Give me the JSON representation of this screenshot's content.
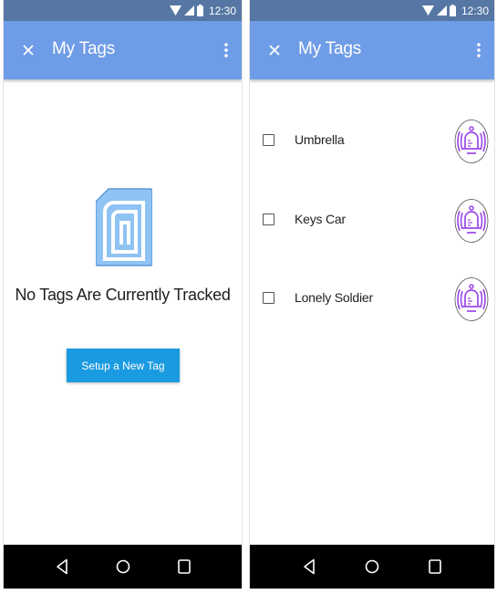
{
  "status": {
    "time": "12:30"
  },
  "colors": {
    "status_bar": "#5677a4",
    "app_bar": "#6f9ce6",
    "button": "#1a9ae0",
    "bell": "#9a47e8"
  },
  "left_screen": {
    "title": "My Tags",
    "empty_message": "No Tags Are Currently Tracked",
    "setup_button_label": "Setup a New Tag"
  },
  "right_screen": {
    "title": "My Tags",
    "tags": [
      {
        "label": "Umbrella",
        "checked": false
      },
      {
        "label": "Keys Car",
        "checked": false
      },
      {
        "label": "Lonely Soldier",
        "checked": false
      }
    ]
  },
  "icons": {
    "close": "close-icon",
    "menu": "more-vert-icon",
    "back": "back-icon",
    "home": "home-icon",
    "recents": "recents-icon",
    "empty": "tag-card-icon",
    "alert": "bell-alert-icon",
    "wifi": "wifi-icon",
    "signal": "signal-icon",
    "battery": "battery-icon"
  }
}
